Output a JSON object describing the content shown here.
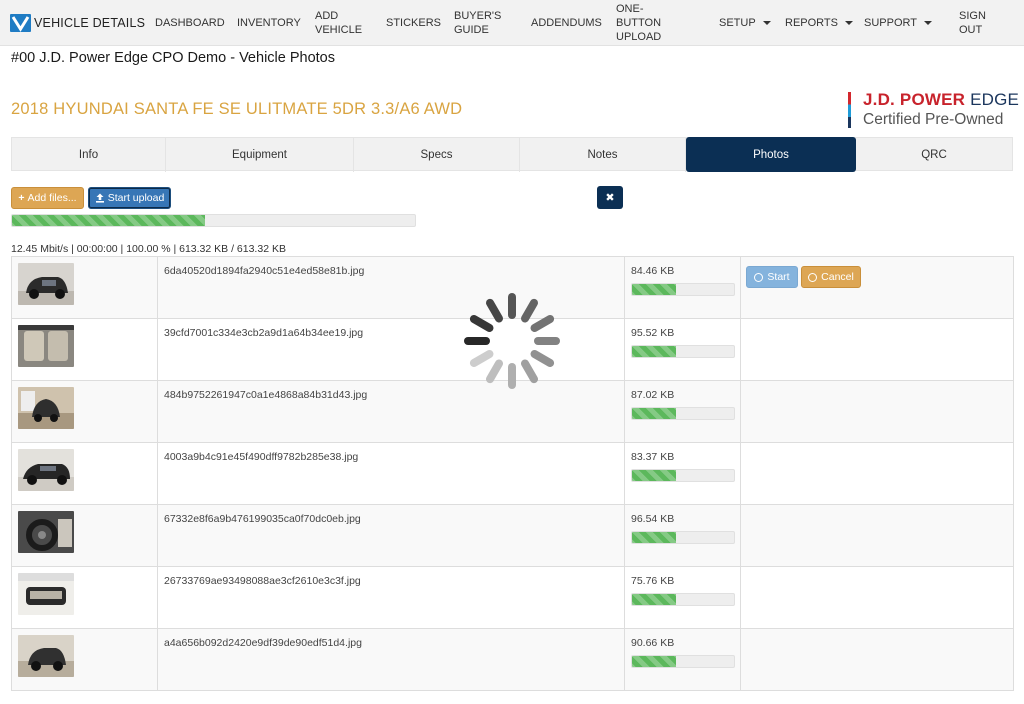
{
  "nav": {
    "brand": "VEHICLE DETAILS",
    "items": [
      "DASHBOARD",
      "INVENTORY",
      "ADD VEHICLE",
      "STICKERS",
      "BUYER'S GUIDE",
      "ADDENDUMS",
      "ONE-BUTTON UPLOAD",
      "SETUP",
      "REPORTS",
      "SUPPORT",
      "SIGN OUT"
    ]
  },
  "page_title": "#00 J.D. Power Edge CPO Demo - Vehicle Photos",
  "vehicle_title": "2018 HYUNDAI SANTA FE SE ULITMATE 5DR 3.3/A6 AWD",
  "logo": {
    "line1_a": "J.D. POWER",
    "line1_b": "EDGE",
    "line2": "Certified Pre-Owned"
  },
  "tabs": [
    "Info",
    "Equipment",
    "Specs",
    "Notes",
    "Photos",
    "QRC"
  ],
  "active_tab": "Photos",
  "upload": {
    "add_files_label": "Add files...",
    "start_upload_label": "Start upload",
    "overall_progress": 0.48,
    "stats": "12.45 Mbit/s | 00:00:00 | 100.00 % | 613.32 KB / 613.32 KB"
  },
  "row_actions": {
    "start_label": "Start",
    "cancel_label": "Cancel"
  },
  "files": [
    {
      "name": "6da40520d1894fa2940c51e4ed58e81b.jpg",
      "size": "84.46 KB",
      "progress": 0.43
    },
    {
      "name": "39cfd7001c334e3cb2a9d1a64b34ee19.jpg",
      "size": "95.52 KB",
      "progress": 0.43
    },
    {
      "name": "484b9752261947c0a1e4868a84b31d43.jpg",
      "size": "87.02 KB",
      "progress": 0.43
    },
    {
      "name": "4003a9b4c91e45f490dff9782b285e38.jpg",
      "size": "83.37 KB",
      "progress": 0.43
    },
    {
      "name": "67332e8f6a9b476199035ca0f70dc0eb.jpg",
      "size": "96.54 KB",
      "progress": 0.43
    },
    {
      "name": "26733769ae93498088ae3cf2610e3c3f.jpg",
      "size": "75.76 KB",
      "progress": 0.43
    },
    {
      "name": "a4a656b092d2420e9df39de90edf51d4.jpg",
      "size": "90.66 KB",
      "progress": 0.43
    }
  ],
  "colors": {
    "accent": "#0b2f54",
    "gold": "#d9a441",
    "success": "#5cb85c",
    "primary": "#3776b6"
  }
}
